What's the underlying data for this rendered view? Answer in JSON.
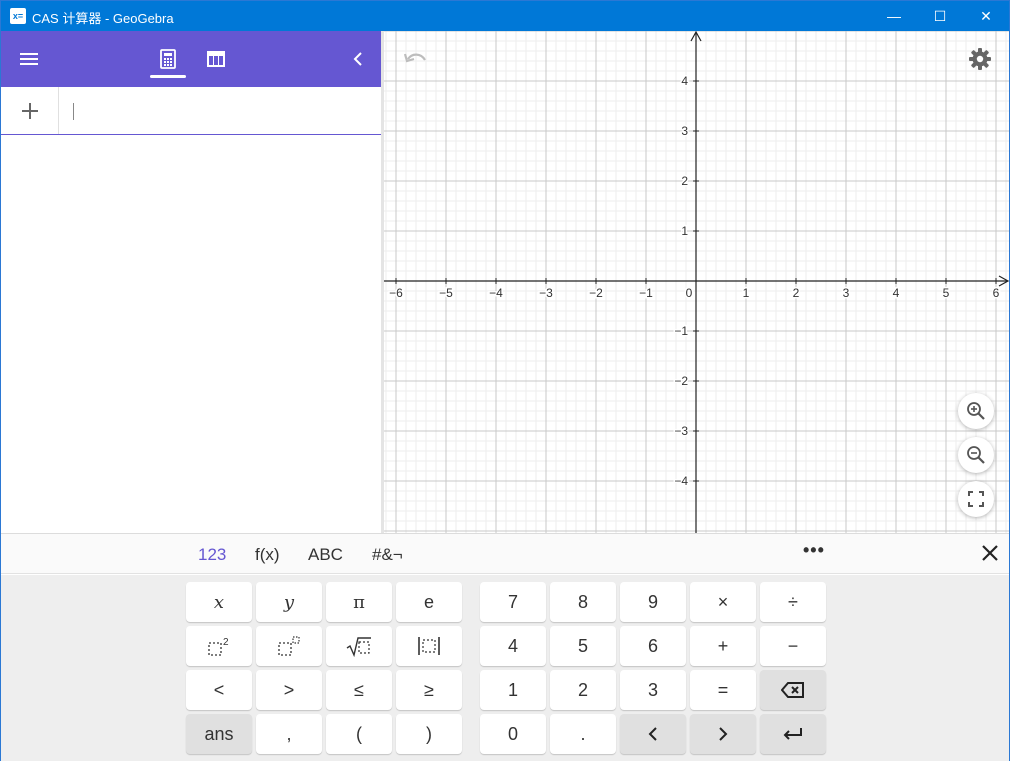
{
  "window": {
    "title": "CAS 计算器 - GeoGebra",
    "icon_text": "x=",
    "controls": {
      "minimize": "—",
      "maximize": "☐",
      "close": "✕"
    }
  },
  "algebra": {
    "header_icons": [
      "menu-icon",
      "calculator-icon",
      "table-icon",
      "chevron-left-icon"
    ],
    "accent_color": "#6557d2",
    "add_icon": "+"
  },
  "graphics": {
    "x_ticks": [
      "−6",
      "−5",
      "−4",
      "−3",
      "−2",
      "−1",
      "0",
      "1",
      "2",
      "3",
      "4",
      "5",
      "6"
    ],
    "y_ticks": [
      "4",
      "3",
      "2",
      "1",
      "−1",
      "−2",
      "−3",
      "−4"
    ],
    "x_range": [
      -6.2,
      6.3
    ],
    "y_range": [
      -5.0,
      5.0
    ]
  },
  "keyboard": {
    "tabs": [
      "123",
      "f(x)",
      "ABC",
      "#&¬"
    ],
    "active_tab": "123",
    "more": "•••",
    "close_icon": "close-icon",
    "left_keys": [
      [
        "x",
        "y",
        "π",
        "e"
      ],
      [
        "□²",
        "□ⁿ",
        "√□",
        "|□|"
      ],
      [
        "<",
        ">",
        "≤",
        "≥"
      ],
      [
        "ans",
        ",",
        "(",
        ")"
      ]
    ],
    "right_keys": [
      [
        "7",
        "8",
        "9",
        "×",
        "÷"
      ],
      [
        "4",
        "5",
        "6",
        "+",
        "−"
      ],
      [
        "1",
        "2",
        "3",
        "=",
        "⌫"
      ],
      [
        "0",
        ".",
        "<",
        ">",
        "↵"
      ]
    ]
  }
}
